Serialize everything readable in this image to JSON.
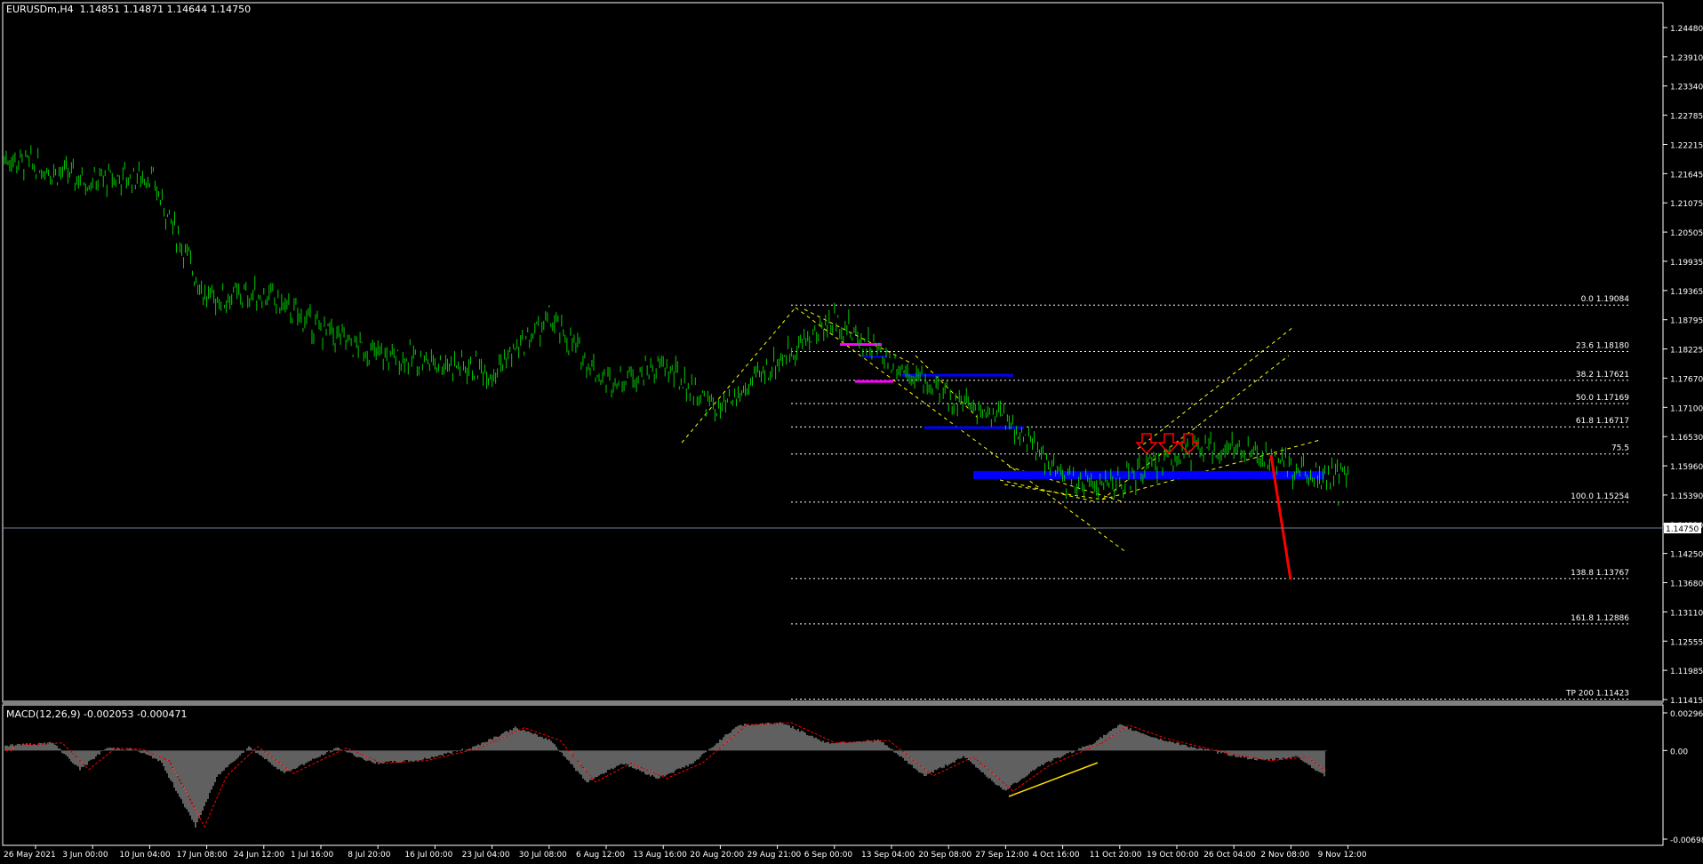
{
  "header": {
    "symbol": "EURUSDm,H4",
    "ohlc": "1.14851 1.14871 1.14644 1.14750"
  },
  "macd_header": "MACD(12,26,9) -0.002053 -0.000471",
  "colors": {
    "background": "#000000",
    "frame": "#ffffff",
    "candles": "#00cc00",
    "fib_lines": "#ffffff",
    "channel_lines": "#ffff00",
    "support_resistance": "#0000ff",
    "box_magenta": "#ff00ff",
    "price_marker_red": "#ff0000",
    "macd_histogram": "#c0c0c0",
    "macd_signal": "#ff0000",
    "divergence_line": "#ffd700",
    "current_price_line": "#708090"
  },
  "chart_data": [
    {
      "type": "candlestick",
      "title": "EURUSDm,H4",
      "x": [
        "26 May 2021",
        "3 Jun 00:00",
        "10 Jun 04:00",
        "17 Jun 08:00",
        "24 Jun 12:00",
        "1 Jul 16:00",
        "8 Jul 20:00",
        "16 Jul 00:00",
        "23 Jul 04:00",
        "30 Jul 08:00",
        "6 Aug 12:00",
        "13 Aug 16:00",
        "20 Aug 20:00",
        "29 Aug 21:00",
        "6 Sep 00:00",
        "13 Sep 04:00",
        "20 Sep 08:00",
        "27 Sep 12:00",
        "4 Oct 16:00",
        "11 Oct 20:00",
        "19 Oct 00:00",
        "26 Oct 04:00",
        "2 Nov 08:00",
        "9 Nov 12:00"
      ],
      "close_series": [
        {
          "x": "26 May 2021",
          "y": 1.2195
        },
        {
          "x": "3 Jun 00:00",
          "y": 1.215
        },
        {
          "x": "10 Jun 04:00",
          "y": 1.216
        },
        {
          "x": "17 Jun 08:00",
          "y": 1.192
        },
        {
          "x": "24 Jun 12:00",
          "y": 1.193
        },
        {
          "x": "1 Jul 16:00",
          "y": 1.186
        },
        {
          "x": "8 Jul 20:00",
          "y": 1.181
        },
        {
          "x": "16 Jul 00:00",
          "y": 1.18
        },
        {
          "x": "23 Jul 04:00",
          "y": 1.178
        },
        {
          "x": "30 Jul 08:00",
          "y": 1.188
        },
        {
          "x": "6 Aug 12:00",
          "y": 1.176
        },
        {
          "x": "13 Aug 16:00",
          "y": 1.179
        },
        {
          "x": "20 Aug 20:00",
          "y": 1.17
        },
        {
          "x": "29 Aug 21:00",
          "y": 1.18
        },
        {
          "x": "6 Sep 00:00",
          "y": 1.188
        },
        {
          "x": "13 Sep 04:00",
          "y": 1.18
        },
        {
          "x": "20 Sep 08:00",
          "y": 1.173
        },
        {
          "x": "27 Sep 12:00",
          "y": 1.169
        },
        {
          "x": "4 Oct 16:00",
          "y": 1.157
        },
        {
          "x": "11 Oct 20:00",
          "y": 1.156
        },
        {
          "x": "19 Oct 00:00",
          "y": 1.162
        },
        {
          "x": "26 Oct 04:00",
          "y": 1.163
        },
        {
          "x": "2 Nov 08:00",
          "y": 1.159
        },
        {
          "x": "9 Nov 12:00",
          "y": 1.1575
        },
        {
          "x": "9 Nov 12:00",
          "y": 1.1475
        }
      ],
      "y_ticks": [
        "1.24480",
        "1.23910",
        "1.23340",
        "1.22785",
        "1.22215",
        "1.21645",
        "1.21075",
        "1.20505",
        "1.19935",
        "1.19365",
        "1.18795",
        "1.18225",
        "1.17670",
        "1.17100",
        "1.16530",
        "1.15960",
        "1.15390",
        "1.14820",
        "1.14250",
        "1.13680",
        "1.13110",
        "1.12555",
        "1.11985",
        "1.11415"
      ],
      "ylim": [
        1.113,
        1.248
      ],
      "current_price": "1.14750",
      "fibonacci_levels": [
        {
          "label": "0.0 1.19084",
          "value": 1.19084
        },
        {
          "label": "23.6 1.18180",
          "value": 1.1818
        },
        {
          "label": "38.2 1.17621",
          "value": 1.17621
        },
        {
          "label": "50.0 1.17169",
          "value": 1.17169
        },
        {
          "label": "61.8 1.16717",
          "value": 1.16717
        },
        {
          "label": "75.5",
          "value": 1.1619
        },
        {
          "label": "100.0 1.15254",
          "value": 1.15254
        },
        {
          "label": "138.8 1.13767",
          "value": 1.13767
        },
        {
          "label": "161.8 1.12886",
          "value": 1.12886
        },
        {
          "label": "TP 200 1.11423",
          "value": 1.11423
        }
      ],
      "horizontal_levels": [
        {
          "value": 1.1772,
          "color": "blue"
        },
        {
          "value": 1.167,
          "color": "blue"
        },
        {
          "value": 1.1578,
          "color": "blue"
        },
        {
          "value": 1.1808,
          "color": "blue"
        },
        {
          "value": 1.1832,
          "color": "magenta"
        },
        {
          "value": 1.176,
          "color": "magenta"
        }
      ],
      "grid": false
    },
    {
      "type": "bar",
      "title": "MACD(12,26,9)",
      "macd": -0.002053,
      "signal": -0.000471,
      "y_ticks": [
        "0.002967",
        "0.00",
        "-0.006988"
      ],
      "ylim": [
        -0.006988,
        0.002967
      ]
    }
  ]
}
